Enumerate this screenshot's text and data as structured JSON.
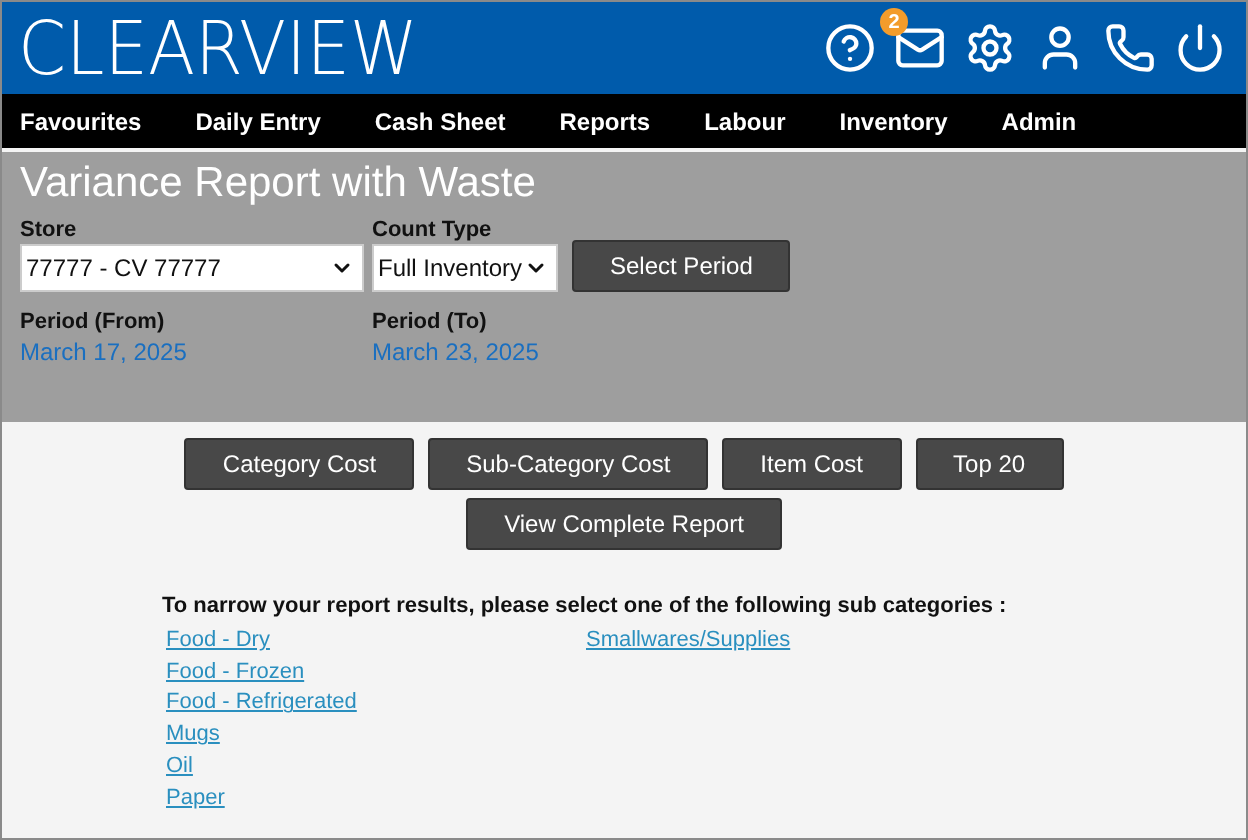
{
  "logo": "CLEARVIEW",
  "header": {
    "notification_count": "2"
  },
  "nav": [
    "Favourites",
    "Daily Entry",
    "Cash Sheet",
    "Reports",
    "Labour",
    "Inventory",
    "Admin"
  ],
  "title": "Variance Report with Waste",
  "store": {
    "label": "Store",
    "value": "77777 - CV 77777"
  },
  "count_type": {
    "label": "Count Type",
    "value": "Full Inventory"
  },
  "select_period_button": "Select Period",
  "period_from": {
    "label": "Period (From)",
    "value": "March 17, 2025"
  },
  "period_to": {
    "label": "Period (To)",
    "value": "March 23, 2025"
  },
  "report_buttons": [
    "Category Cost",
    "Sub-Category Cost",
    "Item Cost",
    "Top 20"
  ],
  "complete_report_button": "View Complete Report",
  "instruction": "To narrow your report results, please select one of the following sub categories :",
  "sub_category_columns": [
    [
      "Food - Dry",
      "Food - Frozen",
      "Food - Refrigerated",
      "Mugs",
      "Oil",
      "Paper"
    ],
    [
      "Smallwares/Supplies"
    ]
  ]
}
